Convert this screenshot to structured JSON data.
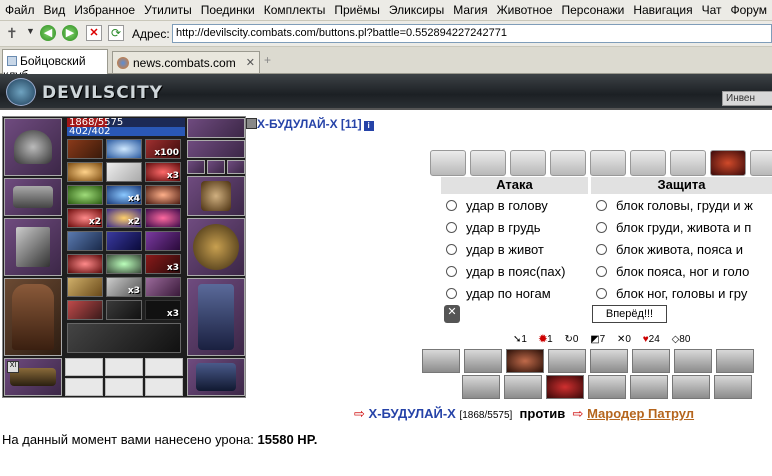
{
  "menu": [
    "Файл",
    "Вид",
    "Избранное",
    "Утилиты",
    "Поединки",
    "Комплекты",
    "Приёмы",
    "Эликсиры",
    "Магия",
    "Животное",
    "Персонажи",
    "Навигация",
    "Чат",
    "Форум"
  ],
  "toolbar": {
    "address_label": "Адрес:",
    "url": "http://devilscity.combats.com/buttons.pl?battle=0.552894227242771"
  },
  "tabs": [
    {
      "label": "Бойцовский клуб"
    },
    {
      "label": "news.combats.com"
    }
  ],
  "banner": {
    "logo": "DEVILSCITY",
    "inventory_label": "Инвен"
  },
  "player": {
    "hp": "1868/5575",
    "mana": "402/402",
    "hp_fraction": 0.335
  },
  "inventory_counts": [
    "x100",
    "x3",
    "x4",
    "x2",
    "x2",
    "x3",
    "x3",
    "x3"
  ],
  "foe": {
    "name": "Х-БУДУЛАЙ-Х [11]"
  },
  "attack": {
    "header": "Атака",
    "options": [
      "удар в голову",
      "удар в грудь",
      "удар в живот",
      "удар в пояс(пах)",
      "удар по ногам"
    ]
  },
  "defense": {
    "header": "Защита",
    "options": [
      "блок головы, груди и ж",
      "блок груди, живота и п",
      "блок живота, пояса и",
      "блок пояса, ног и голо",
      "блок ног, головы и гру"
    ]
  },
  "go_button": "Вперёд!!!",
  "stats": [
    "1",
    "1",
    "0",
    "7",
    "0",
    "24",
    "80"
  ],
  "versus": {
    "player": "Х-БУДУЛАЙ-Х",
    "player_hp": "[1868/5575]",
    "vs": "против",
    "enemy": "Мародер Патрул"
  },
  "damage": {
    "text": "На данный момент вами нанесено урона:",
    "value": "15580 HP."
  },
  "colors": {
    "accent": "#2643a8",
    "enemy": "#b5651d",
    "hp": "#a21717",
    "mana": "#2a58b5"
  }
}
